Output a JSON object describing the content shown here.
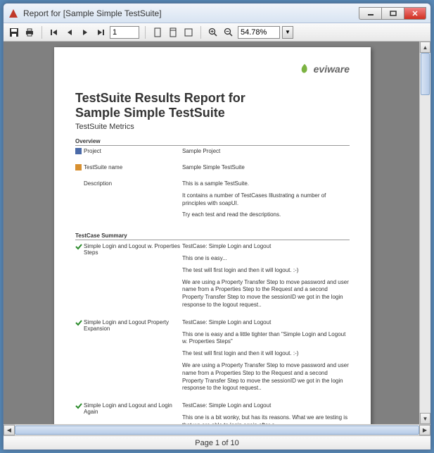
{
  "window": {
    "title": "Report for [Sample Simple TestSuite]"
  },
  "toolbar": {
    "page_input": "1",
    "zoom_value": "54.78%"
  },
  "logo": {
    "text": "eviware"
  },
  "report": {
    "title_line1": "TestSuite Results Report for",
    "title_line2": "Sample Simple TestSuite",
    "subtitle": "TestSuite Metrics",
    "overview_heading": "Overview",
    "overview": [
      {
        "icon": "project",
        "key": "Project",
        "value": "Sample Project"
      },
      {
        "icon": "suite",
        "key": "TestSuite name",
        "value": "Sample Simple TestSuite"
      },
      {
        "icon": "",
        "key": "Description",
        "value": "This is a sample TestSuite.\n\nIt contains a number of TestCases Illustrating a number of principles with soapUI.\n\nTry each test and read the descriptions."
      }
    ],
    "testcase_heading": "TestCase Summary",
    "testcases": [
      {
        "name": "Simple Login and Logout w. Properties Steps",
        "desc": "TestCase: Simple Login and Logout\n\nThis one is easy...\n\nThe test will first login and then it will logout. :-)\n\nWe are using a Property Transfer Step to  move password and user name from a Properties Step to the Request and a second Property Transfer Step to move the sessionID we got in the login response to the logout request.."
      },
      {
        "name": "Simple Login and Logout Property Expansion",
        "desc": "TestCase: Simple Login and Logout\n\nThis one is easy and a little tighter than \"Simple Login and Logout w. Properties Steps\"\n\nThe test will first login and then it will logout. :-)\n\nWe are using a Property Transfer Step to  move password and user name from a Properties Step to the Request and a second Property Transfer Step to move the sessionID we got in the login response to the logout request.."
      },
      {
        "name": "Simple Login and Logout and Login Again",
        "desc": "TestCase: Simple Login and Logout\n\nThis one is a bit wonky, but has its reasons. What we are testing is that we are able to login again after a"
      }
    ]
  },
  "status": {
    "page_text": "Page 1 of 10"
  }
}
